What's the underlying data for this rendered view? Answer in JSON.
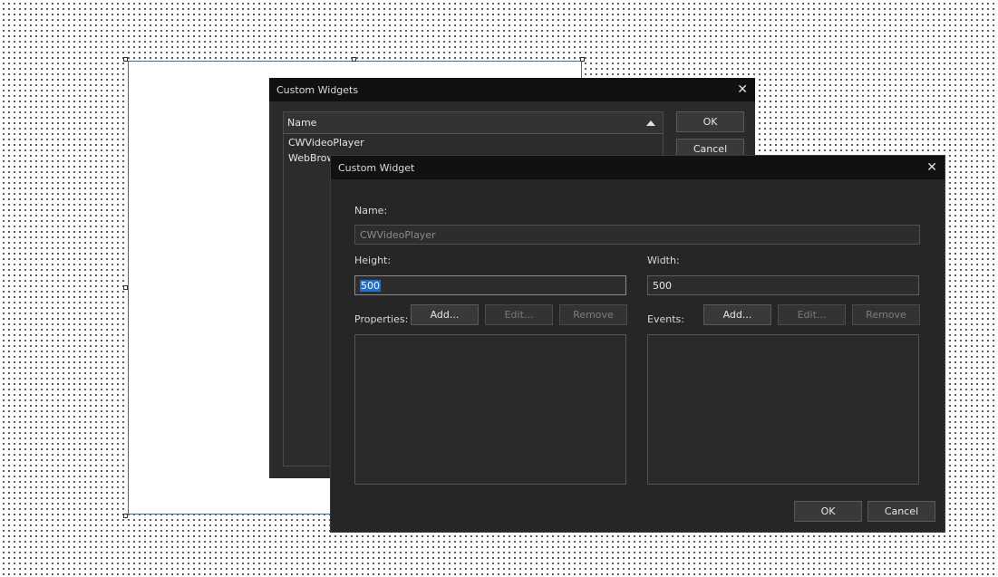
{
  "custom_widgets_dialog": {
    "title": "Custom Widgets",
    "column_header": "Name",
    "items": [
      "CWVideoPlayer",
      "WebBrowser"
    ],
    "ok_label": "OK",
    "cancel_label": "Cancel"
  },
  "custom_widget_dialog": {
    "title": "Custom Widget",
    "name_label": "Name:",
    "name_value": "CWVideoPlayer",
    "height_label": "Height:",
    "height_value": "500",
    "width_label": "Width:",
    "width_value": "500",
    "properties_label": "Properties:",
    "events_label": "Events:",
    "add_label": "Add...",
    "edit_label": "Edit...",
    "remove_label": "Remove",
    "ok_label": "OK",
    "cancel_label": "Cancel"
  },
  "icons": {
    "close": "close-icon",
    "sort": "sort-ascending-icon"
  }
}
